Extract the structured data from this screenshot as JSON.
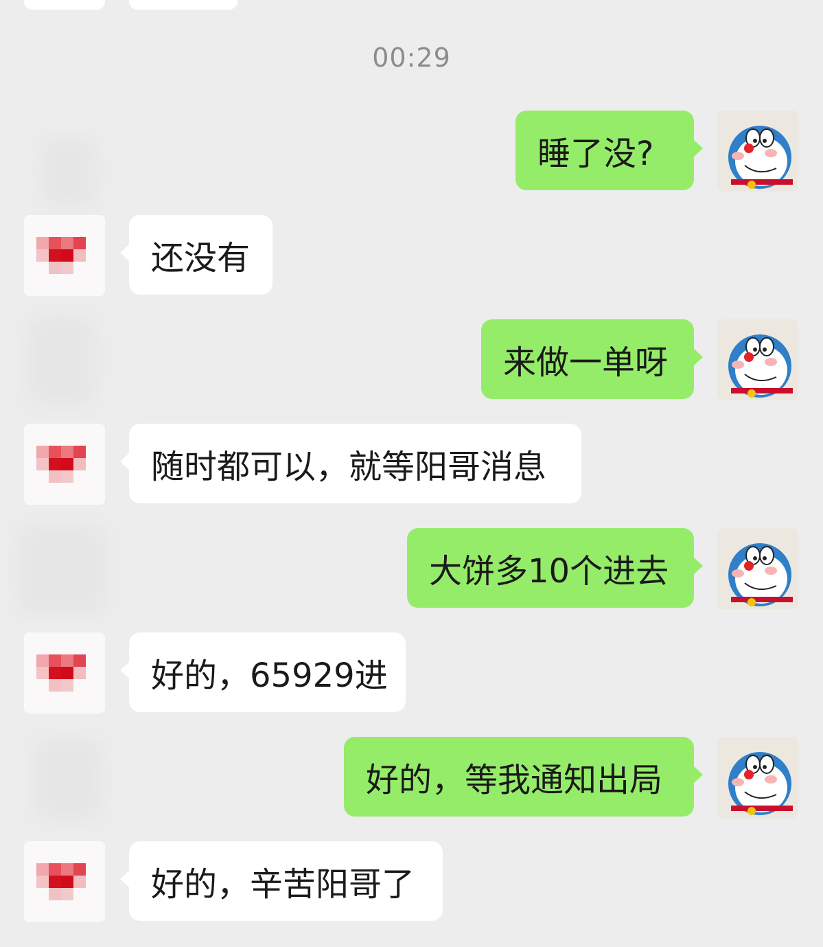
{
  "chat": {
    "timestamp": "00:29",
    "messages": [
      {
        "from": "me",
        "text": "睡了没?"
      },
      {
        "from": "them",
        "text": "还没有"
      },
      {
        "from": "me",
        "text": "来做一单呀"
      },
      {
        "from": "them",
        "text": "随时都可以，就等阳哥消息"
      },
      {
        "from": "me",
        "text": "大饼多10个进去"
      },
      {
        "from": "them",
        "text": "好的，65929进"
      },
      {
        "from": "me",
        "text": "好的，等我通知出局"
      },
      {
        "from": "them",
        "text": "好的，辛苦阳哥了"
      }
    ]
  },
  "colors": {
    "background": "#ededed",
    "my_bubble": "#95ec69",
    "their_bubble": "#ffffff",
    "timestamp_text": "#8c8c8c"
  },
  "icons": {
    "my_avatar": "doraemon-avatar-icon",
    "their_avatar": "pixelated-red-heart-avatar-icon"
  }
}
